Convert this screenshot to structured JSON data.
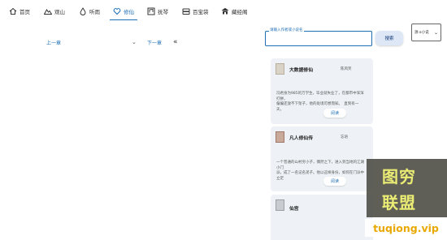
{
  "nav": {
    "items": [
      {
        "label": "首页",
        "icon": "home-icon"
      },
      {
        "label": "观山",
        "icon": "mountain-icon"
      },
      {
        "label": "听雨",
        "icon": "raindrop-icon"
      },
      {
        "label": "修仙",
        "icon": "heart-icon",
        "active": true
      },
      {
        "label": "抚琴",
        "icon": "music-sheet-icon"
      },
      {
        "label": "百宝袋",
        "icon": "bag-icon"
      },
      {
        "label": "藏经阁",
        "icon": "pavilion-icon"
      }
    ],
    "active_color": "#1f6fb5"
  },
  "chapter": {
    "prev": "上一章",
    "next": "下一章"
  },
  "search": {
    "placeholder": "请输入作者或小说名",
    "button": "搜索"
  },
  "source_select": {
    "value": "源·a小说"
  },
  "books": [
    {
      "title": "大数据修仙",
      "author": "陈风笑",
      "desc_line1": "冯君身为985的万学生，毕业就失业了，在都市中浑浑打拼，",
      "desc_line2": "偏偏还放不下架子，他的处境可想而知。　直到有一天，",
      "read": "阅读"
    },
    {
      "title": "凡人修仙传",
      "author": "忘语",
      "desc_line1": "一个普通的山村穷小子，偶然之下，进入到当地的江湖小门",
      "desc_line2": "派，成了一名记名弟子。他以这样身份，如何在门派中立足",
      "read": "阅读"
    },
    {
      "title": "仙宫",
      "author": "",
      "desc_line1": "",
      "desc_line2": "",
      "read": ""
    }
  ],
  "watermark": {
    "line1": "图穷",
    "line2": "联盟",
    "url": "tuqiong.vip"
  }
}
